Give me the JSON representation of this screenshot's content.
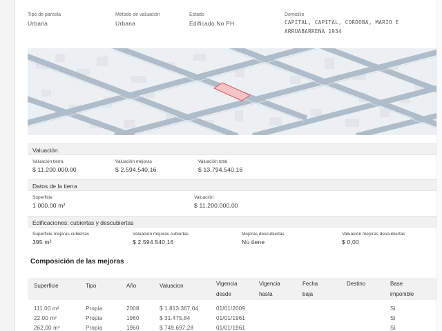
{
  "parcel_info": {
    "tipo_label": "Tipo de parcela",
    "tipo_value": "Urbana",
    "metodo_label": "Método de valuación",
    "metodo_value": "Urbana",
    "estado_label": "Estado",
    "estado_value": "Edificado No PH",
    "domicilio_label": "Domicilio",
    "domicilio_line1": "CAPITAL, CAPITAL, CORDOBA, MARIO E",
    "domicilio_line2": "ARRUABARRENA 1934"
  },
  "valuacion": {
    "title": "Valuación",
    "tierra_label": "Valuación tierra",
    "tierra_value": "$ 11.200.000,00",
    "mejoras_label": "Valuación mejoras",
    "mejoras_value": "$ 2.594.540,16",
    "total_label": "Valuación total",
    "total_value": "$ 13.794.540,16"
  },
  "datos_tierra": {
    "title": "Datos de la tierra",
    "superficie_label": "Superficie",
    "superficie_value": "1 000.00 m²",
    "valuacion_label": "Valuación",
    "valuacion_value": "$ 11.200.000,00"
  },
  "edificaciones": {
    "title": "Edificaciones: cubiertas y descubiertas",
    "sup_cub_label": "Superficie mejoras cubiertas",
    "sup_cub_value": "395 m²",
    "val_cub_label": "Valuación mejoras cubiertas",
    "val_cub_value": "$ 2.594.540,16",
    "mej_desc_label": "Mejoras descubiertas",
    "mej_desc_value": "No tiene",
    "val_desc_label": "Valuación mejoras descubiertas",
    "val_desc_value": "$ 0,00"
  },
  "composicion": {
    "title": "Composición de las mejoras",
    "headers": {
      "superficie": "Superficie",
      "tipo": "Tipo",
      "anio": "Año",
      "valuacion": "Valuacion",
      "vigencia_desde_1": "Vigencia",
      "vigencia_desde_2": "desde",
      "vigencia_hasta_1": "Vigencia",
      "vigencia_hasta_2": "hasta",
      "fecha_baja_1": "Fecha",
      "fecha_baja_2": "baja",
      "destino": "Destino",
      "base_1": "Base",
      "base_2": "imponible"
    },
    "rows": [
      {
        "superficie": "111.00 m²",
        "tipo": "Propia",
        "anio": "2008",
        "valuacion": "$ 1.813.367,04",
        "desde": "01/01/2009",
        "base": "Si"
      },
      {
        "superficie": "22.00 m²",
        "tipo": "Propia",
        "anio": "1960",
        "valuacion": "$ 31.475,84",
        "desde": "01/01/1961",
        "base": "Si"
      },
      {
        "superficie": "262.00 m²",
        "tipo": "Propia",
        "anio": "1960",
        "valuacion": "$ 749.697,28",
        "desde": "01/01/1961",
        "base": "Si"
      }
    ]
  }
}
